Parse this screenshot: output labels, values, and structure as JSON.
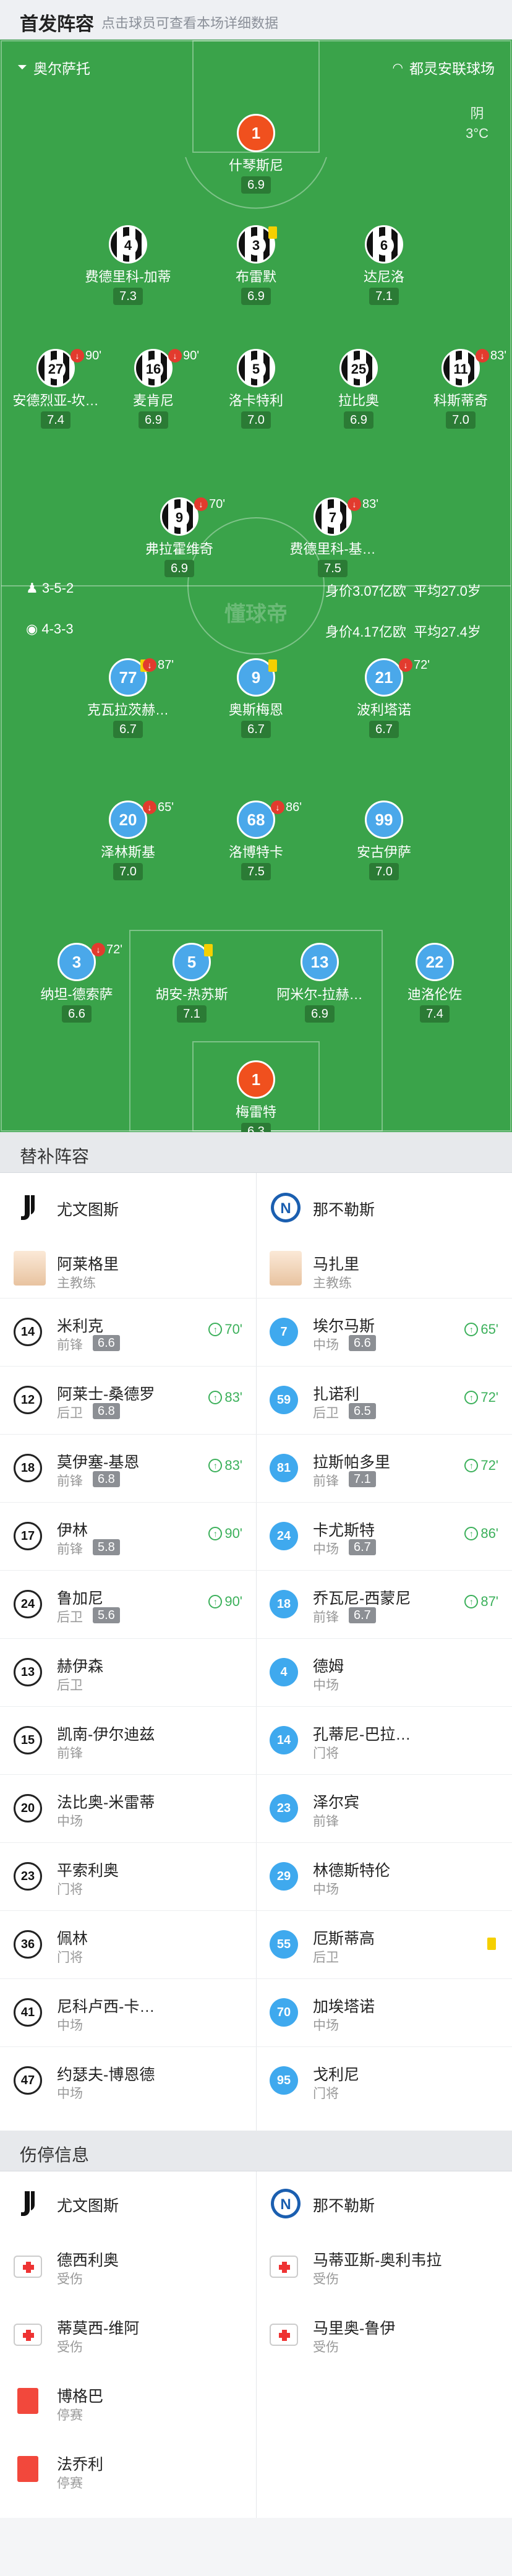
{
  "header": {
    "title": "首发阵容",
    "subtitle": "点击球员可查看本场详细数据"
  },
  "pitch": {
    "referee": "奥尔萨托",
    "venue": "都灵安联球场",
    "weather": "阴",
    "temp": "3°C",
    "juve": {
      "formation": "3-5-2",
      "value": "身价3.07亿欧",
      "age": "平均27.0岁"
    },
    "napoli": {
      "formation": "4-3-3",
      "value": "身价4.17亿欧",
      "age": "平均27.4岁"
    },
    "watermark": "懂球帝",
    "players": [
      {
        "id": "p1",
        "num": "1",
        "name": "什琴斯尼",
        "rating": "6.9"
      },
      {
        "id": "p4",
        "num": "4",
        "name": "费德里科-加蒂",
        "rating": "7.3"
      },
      {
        "id": "p3",
        "num": "3",
        "name": "布雷默",
        "rating": "6.9"
      },
      {
        "id": "p6",
        "num": "6",
        "name": "达尼洛",
        "rating": "7.1"
      },
      {
        "id": "p27",
        "num": "27",
        "name": "安德烈亚-坎…",
        "rating": "7.4",
        "sub": "90'"
      },
      {
        "id": "p16",
        "num": "16",
        "name": "麦肯尼",
        "rating": "6.9",
        "sub": "90'"
      },
      {
        "id": "p5",
        "num": "5",
        "name": "洛卡特利",
        "rating": "7.0"
      },
      {
        "id": "p25",
        "num": "25",
        "name": "拉比奥",
        "rating": "6.9"
      },
      {
        "id": "p11",
        "num": "11",
        "name": "科斯蒂奇",
        "rating": "7.0",
        "sub": "83'"
      },
      {
        "id": "p9",
        "num": "9",
        "name": "弗拉霍维奇",
        "rating": "6.9",
        "sub": "70'"
      },
      {
        "id": "p7",
        "num": "7",
        "name": "费德里科-基…",
        "rating": "7.5",
        "sub": "83'"
      },
      {
        "id": "n77",
        "num": "77",
        "name": "克瓦拉茨赫…",
        "rating": "6.7",
        "sub": "87'"
      },
      {
        "id": "n9",
        "num": "9",
        "name": "奥斯梅恩",
        "rating": "6.7"
      },
      {
        "id": "n21",
        "num": "21",
        "name": "波利塔诺",
        "rating": "6.7",
        "sub": "72'"
      },
      {
        "id": "n20",
        "num": "20",
        "name": "泽林斯基",
        "rating": "7.0",
        "sub": "65'"
      },
      {
        "id": "n68",
        "num": "68",
        "name": "洛博特卡",
        "rating": "7.5",
        "sub": "86'"
      },
      {
        "id": "n99",
        "num": "99",
        "name": "安古伊萨",
        "rating": "7.0"
      },
      {
        "id": "n3",
        "num": "3",
        "name": "纳坦-德索萨",
        "rating": "6.6",
        "sub": "72'"
      },
      {
        "id": "n5",
        "num": "5",
        "name": "胡安-热苏斯",
        "rating": "7.1"
      },
      {
        "id": "n13",
        "num": "13",
        "name": "阿米尔-拉赫…",
        "rating": "6.9"
      },
      {
        "id": "n22",
        "num": "22",
        "name": "迪洛伦佐",
        "rating": "7.4"
      },
      {
        "id": "n1",
        "num": "1",
        "name": "梅雷特",
        "rating": "6.3"
      }
    ]
  },
  "subs": {
    "title": "替补阵容",
    "home": "尤文图斯",
    "away": "那不勒斯",
    "coach_home": {
      "name": "阿莱格里",
      "role": "主教练"
    },
    "coach_away": {
      "name": "马扎里",
      "role": "主教练"
    },
    "home_list": [
      {
        "num": "14",
        "name": "米利克",
        "pos": "前锋",
        "score": "6.6",
        "min": "70'"
      },
      {
        "num": "12",
        "name": "阿莱士-桑德罗",
        "pos": "后卫",
        "score": "6.8",
        "min": "83'"
      },
      {
        "num": "18",
        "name": "莫伊塞-基恩",
        "pos": "前锋",
        "score": "6.8",
        "min": "83'"
      },
      {
        "num": "17",
        "name": "伊林",
        "pos": "前锋",
        "score": "5.8",
        "min": "90'"
      },
      {
        "num": "24",
        "name": "鲁加尼",
        "pos": "后卫",
        "score": "5.6",
        "min": "90'"
      },
      {
        "num": "13",
        "name": "赫伊森",
        "pos": "后卫"
      },
      {
        "num": "15",
        "name": "凯南-伊尔迪兹",
        "pos": "前锋"
      },
      {
        "num": "20",
        "name": "法比奥-米雷蒂",
        "pos": "中场"
      },
      {
        "num": "23",
        "name": "平索利奥",
        "pos": "门将"
      },
      {
        "num": "36",
        "name": "佩林",
        "pos": "门将"
      },
      {
        "num": "41",
        "name": "尼科卢西-卡…",
        "pos": "中场"
      },
      {
        "num": "47",
        "name": "约瑟夫-博恩德",
        "pos": "中场"
      }
    ],
    "away_list": [
      {
        "num": "7",
        "name": "埃尔马斯",
        "pos": "中场",
        "score": "6.6",
        "min": "65'"
      },
      {
        "num": "59",
        "name": "扎诺利",
        "pos": "后卫",
        "score": "6.5",
        "min": "72'"
      },
      {
        "num": "81",
        "name": "拉斯帕多里",
        "pos": "前锋",
        "score": "7.1",
        "min": "72'"
      },
      {
        "num": "24",
        "name": "卡尤斯特",
        "pos": "中场",
        "score": "6.7",
        "min": "86'"
      },
      {
        "num": "18",
        "name": "乔瓦尼-西蒙尼",
        "pos": "前锋",
        "score": "6.7",
        "min": "87'"
      },
      {
        "num": "4",
        "name": "德姆",
        "pos": "中场"
      },
      {
        "num": "14",
        "name": "孔蒂尼-巴拉…",
        "pos": "门将"
      },
      {
        "num": "23",
        "name": "泽尔宾",
        "pos": "前锋"
      },
      {
        "num": "29",
        "name": "林德斯特伦",
        "pos": "中场"
      },
      {
        "num": "55",
        "name": "厄斯蒂高",
        "pos": "后卫",
        "card": "yellow"
      },
      {
        "num": "70",
        "name": "加埃塔诺",
        "pos": "中场"
      },
      {
        "num": "95",
        "name": "戈利尼",
        "pos": "门将"
      }
    ]
  },
  "injury": {
    "title": "伤停信息",
    "home": "尤文图斯",
    "away": "那不勒斯",
    "home_list": [
      {
        "name": "德西利奥",
        "status": "受伤",
        "type": "injury"
      },
      {
        "name": "蒂莫西-维阿",
        "status": "受伤",
        "type": "injury"
      },
      {
        "name": "博格巴",
        "status": "停赛",
        "type": "red"
      },
      {
        "name": "法乔利",
        "status": "停赛",
        "type": "red"
      }
    ],
    "away_list": [
      {
        "name": "马蒂亚斯-奥利韦拉",
        "status": "受伤",
        "type": "injury"
      },
      {
        "name": "马里奥-鲁伊",
        "status": "受伤",
        "type": "injury"
      }
    ]
  },
  "colors": {
    "pitch": "#3aa34a",
    "napoli": "#3fa9ee",
    "gk": "#f0501e",
    "sub_in": "#3bb05a",
    "red": "#f2483c",
    "yellow": "#f5d000"
  }
}
